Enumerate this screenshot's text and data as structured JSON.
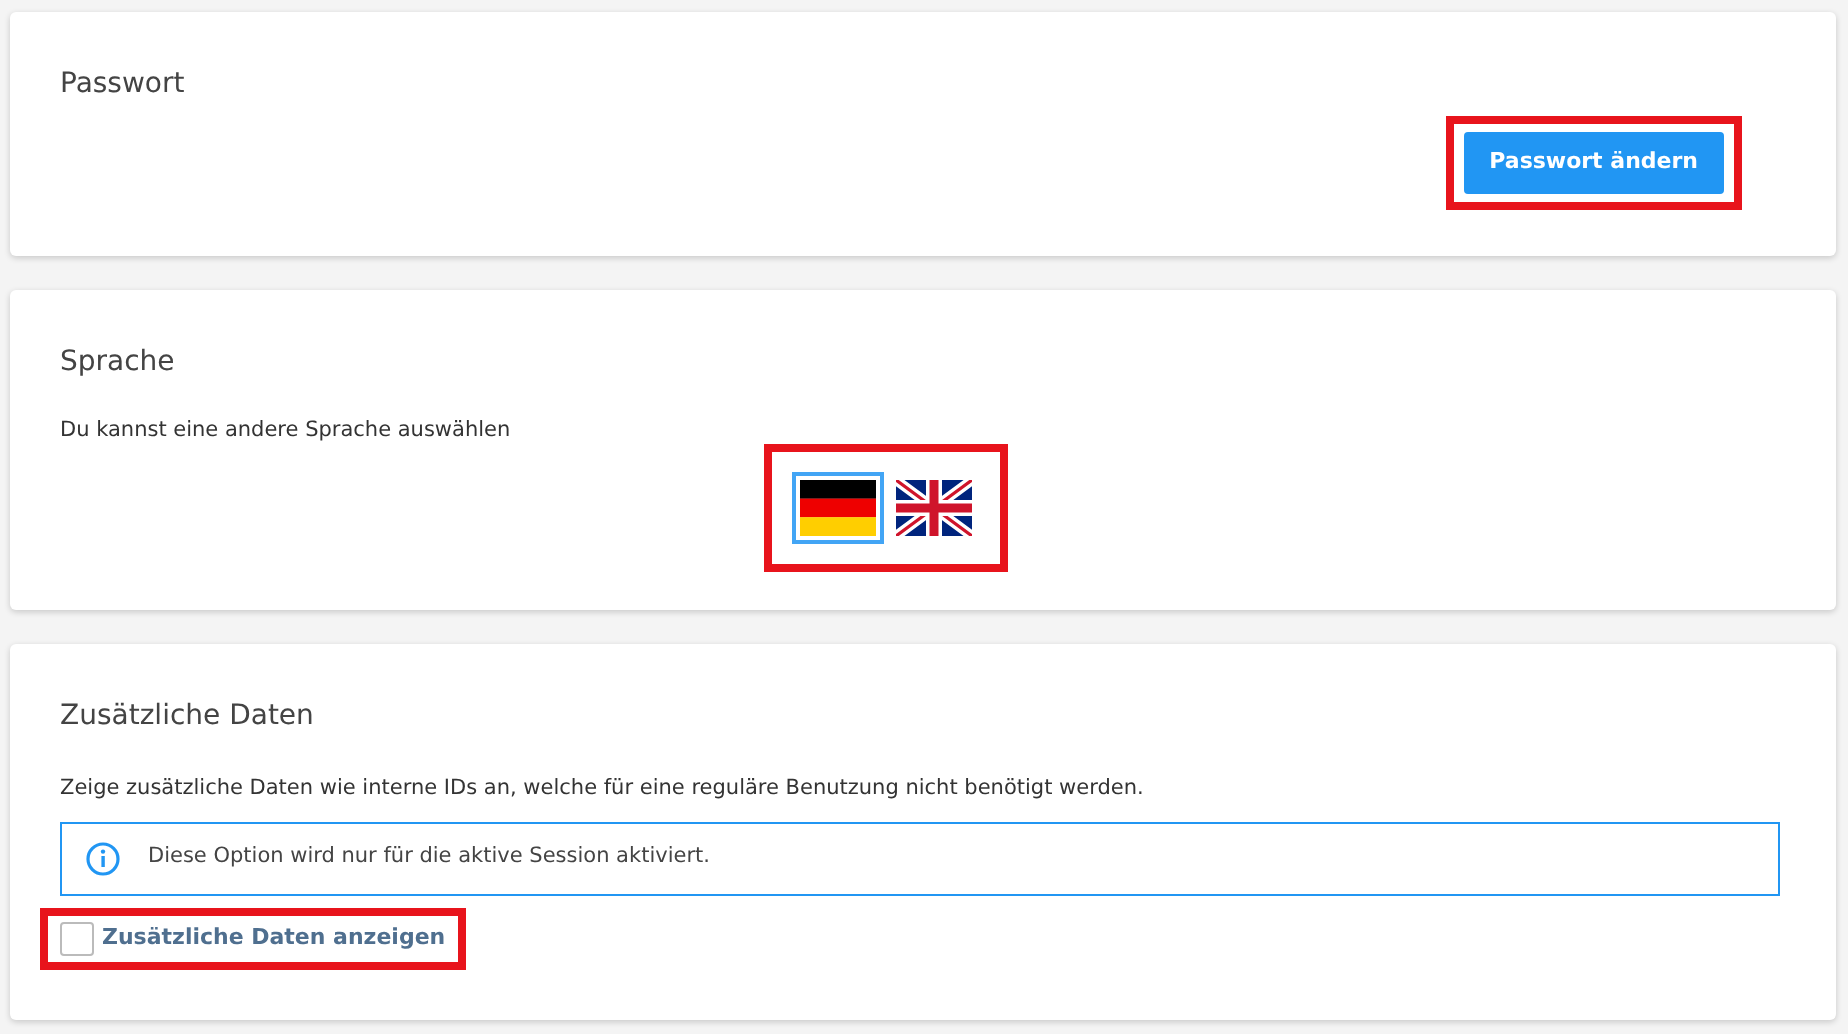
{
  "sections": [
    {
      "kind": "password",
      "title": "Passwort",
      "button": {
        "label": "Passwort ändern",
        "highlighted": true
      }
    },
    {
      "kind": "language",
      "title": "Sprache",
      "text": "Du kannst eine andere Sprache auswählen",
      "highlighted": true,
      "languages": [
        {
          "kind": "de",
          "selected": true
        },
        {
          "kind": "uk",
          "selected": false
        }
      ]
    },
    {
      "kind": "extra",
      "title": "Zusätzliche Daten",
      "text": "Zeige zusätzliche Daten wie interne IDs an, welche für eine reguläre Benutzung nicht benötigt werden.",
      "info": "Diese Option wird nur für die aktive Session aktiviert.",
      "checkbox": {
        "label": "Zusätzliche Daten anzeigen",
        "checked": false,
        "highlighted": true
      }
    }
  ]
}
